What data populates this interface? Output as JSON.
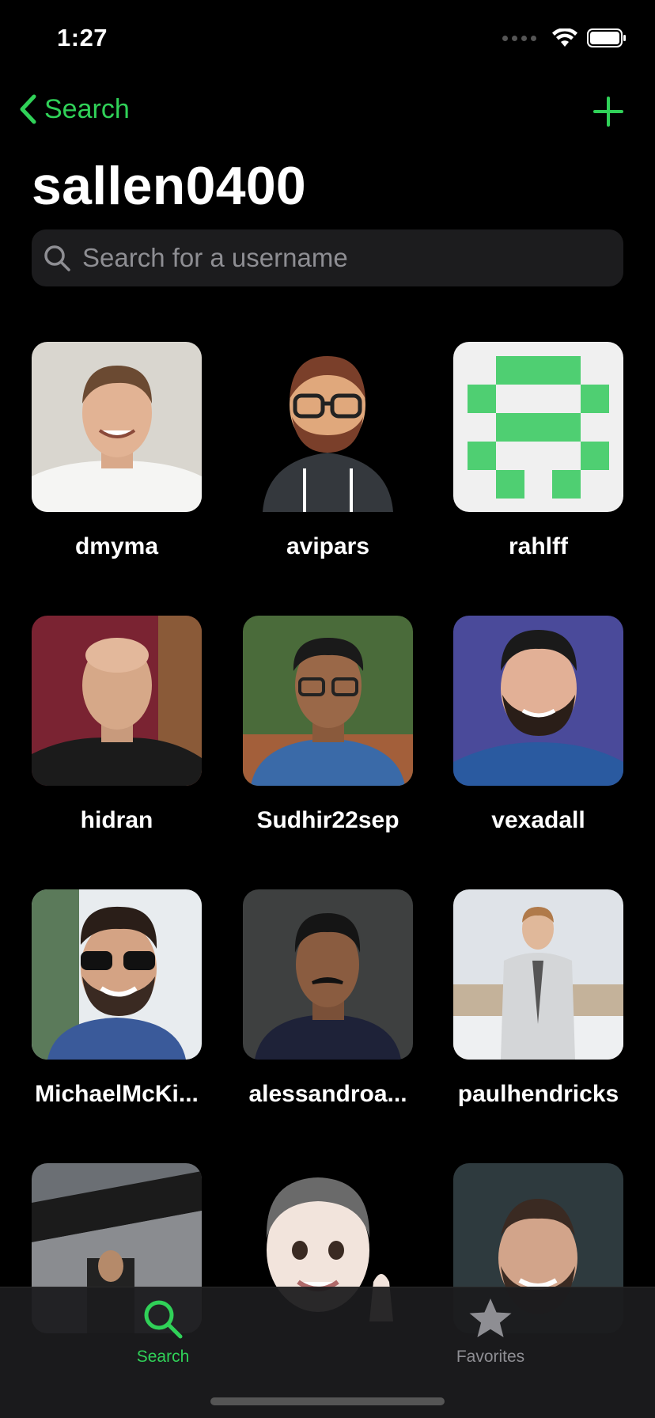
{
  "status": {
    "time": "1:27"
  },
  "nav": {
    "back_label": "Search"
  },
  "page": {
    "title": "sallen0400"
  },
  "search": {
    "placeholder": "Search for a username",
    "value": ""
  },
  "followers": [
    {
      "username": "dmyma",
      "avatar": "photo-man-smiling"
    },
    {
      "username": "avipars",
      "avatar": "cartoon-bearded-man"
    },
    {
      "username": "rahlff",
      "avatar": "identicon-green"
    },
    {
      "username": "hidran",
      "avatar": "photo-bald-man"
    },
    {
      "username": "Sudhir22sep",
      "avatar": "photo-man-glasses"
    },
    {
      "username": "vexadall",
      "avatar": "photo-man-beard"
    },
    {
      "username": "MichaelMcKi...",
      "avatar": "photo-man-sunglasses"
    },
    {
      "username": "alessandroa...",
      "avatar": "photo-man-moustache"
    },
    {
      "username": "paulhendricks",
      "avatar": "photo-man-suit"
    },
    {
      "username": "",
      "avatar": "photo-subway-sign"
    },
    {
      "username": "",
      "avatar": "memoji-thumbs-up"
    },
    {
      "username": "",
      "avatar": "photo-man-bald-beard"
    }
  ],
  "tabs": [
    {
      "label": "Search",
      "icon": "search-icon",
      "active": true
    },
    {
      "label": "Favorites",
      "icon": "star-icon",
      "active": false
    }
  ],
  "colors": {
    "accent": "#30d158",
    "background": "#000000",
    "search_bg": "#1c1c1e",
    "tab_inactive": "#8e8e93"
  }
}
